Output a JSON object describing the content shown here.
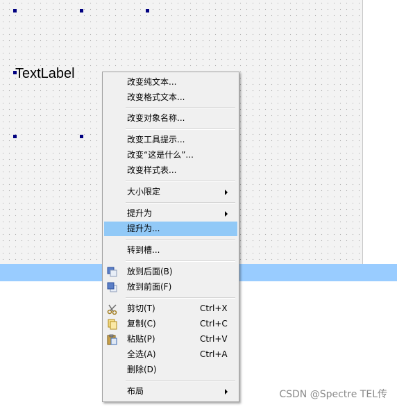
{
  "canvas": {
    "text_label": "TextLabel"
  },
  "context_menu": {
    "items": [
      {
        "label": "改变纯文本..."
      },
      {
        "label": "改变格式文本..."
      },
      {
        "label": "改变对象名称..."
      },
      {
        "label": "改变工具提示..."
      },
      {
        "label": "改变“这是什么”..."
      },
      {
        "label": "改变样式表..."
      },
      {
        "label": "大小限定",
        "submenu": true
      },
      {
        "label": "提升为",
        "submenu": true
      },
      {
        "label": "提升为...",
        "highlighted": true
      },
      {
        "label": "转到槽..."
      },
      {
        "label": "放到后面(B)",
        "icon": "send-to-back-icon"
      },
      {
        "label": "放到前面(F)",
        "icon": "bring-to-front-icon"
      },
      {
        "label": "剪切(T)",
        "shortcut": "Ctrl+X",
        "icon": "scissors-icon"
      },
      {
        "label": "复制(C)",
        "shortcut": "Ctrl+C",
        "icon": "copy-icon"
      },
      {
        "label": "粘贴(P)",
        "shortcut": "Ctrl+V",
        "icon": "paste-icon"
      },
      {
        "label": "全选(A)",
        "shortcut": "Ctrl+A"
      },
      {
        "label": "删除(D)"
      },
      {
        "label": "布局",
        "submenu": true
      }
    ],
    "highlight_color": "#91c9f7"
  },
  "watermark": "CSDN @Spectre TEL传"
}
